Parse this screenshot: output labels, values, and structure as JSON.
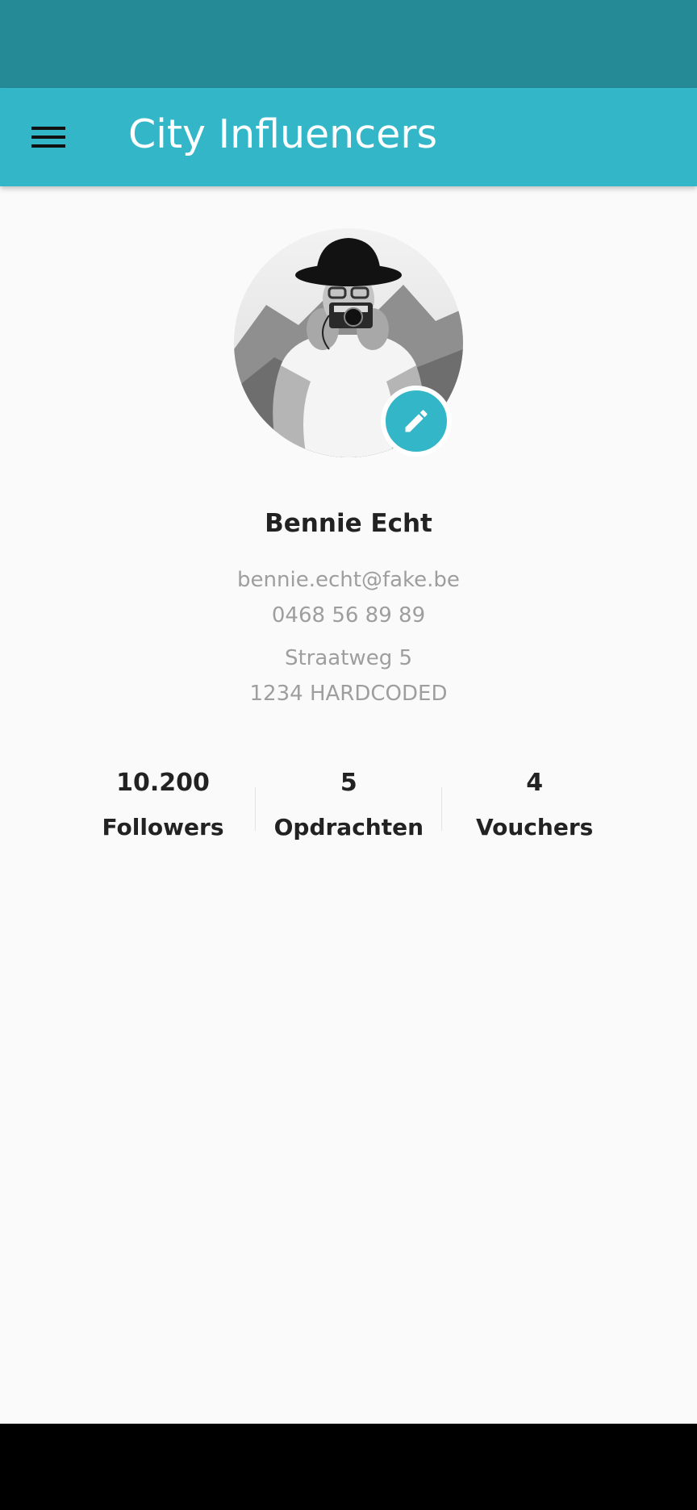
{
  "app_bar": {
    "title": "City Influencers",
    "menu_icon": "menu-icon"
  },
  "profile": {
    "name": "Bennie Echt",
    "email": "bennie.echt@fake.be",
    "phone": "0468 56 89 89",
    "street": "Straatweg 5",
    "city": "1234 HARDCODED",
    "edit_icon": "pencil-icon"
  },
  "stats": [
    {
      "value": "10.200",
      "label": "Followers"
    },
    {
      "value": "5",
      "label": "Opdrachten"
    },
    {
      "value": "4",
      "label": "Vouchers"
    }
  ],
  "colors": {
    "status_bar": "#268a96",
    "app_bar": "#33b6c7",
    "accent": "#33b6c7",
    "text_primary": "#222222",
    "text_secondary": "#9e9e9e",
    "background": "#fafafa"
  }
}
